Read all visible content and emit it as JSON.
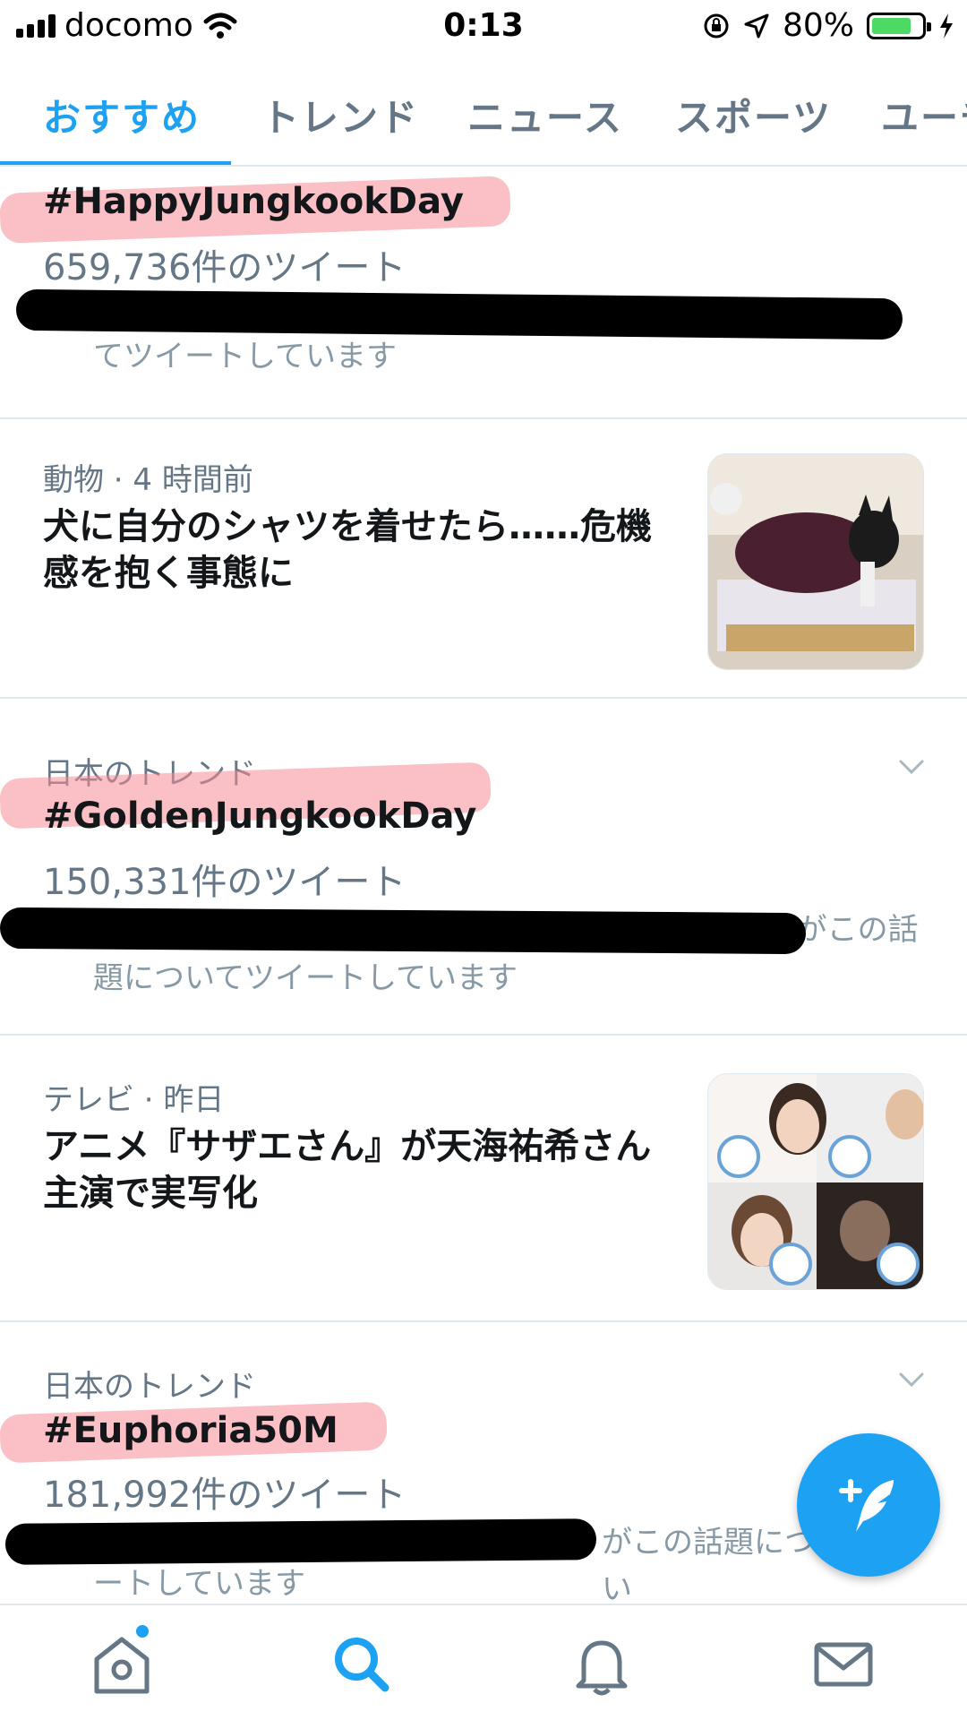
{
  "status_bar": {
    "carrier": "docomo",
    "time": "0:13",
    "battery": "80%",
    "battery_level": 0.8,
    "battery_color": "#4cd964"
  },
  "tabs": [
    {
      "label": "おすすめ",
      "active": true
    },
    {
      "label": "トレンド",
      "active": false
    },
    {
      "label": "ニュース",
      "active": false
    },
    {
      "label": "スポーツ",
      "active": false
    },
    {
      "label": "ユーチ",
      "active": false
    }
  ],
  "feed": {
    "item1": {
      "tag": "#HappyJungkookDay",
      "tweet_count": "659,736件のツイート",
      "desc_line2": "てツイートしています"
    },
    "item2": {
      "meta": "動物 · 4 時間前",
      "headline": "犬に自分のシャツを着せたら……危機感を抱く事態に",
      "thumb_icon": "dog-photo"
    },
    "item3": {
      "meta": "日本のトレンド",
      "tag": "#GoldenJungkookDay",
      "tweet_count": "150,331件のツイート",
      "desc_line1_tail": "他3人がこの話",
      "desc_line2": "題についてツイートしています"
    },
    "item4": {
      "meta": "テレビ · 昨日",
      "headline": "アニメ『サザエさん』が天海祐希さん主演で実写化",
      "thumb_icon": "cast-collage-photo"
    },
    "item5": {
      "meta": "日本のトレンド",
      "tag": "#Euphoria50M",
      "tweet_count": "181,992件のツイート",
      "desc_line1_tail": "がこの話題につい",
      "desc_line2": "ートしています"
    }
  },
  "colors": {
    "accent": "#1da1f2",
    "highlight": "#f58c96",
    "secondary_text": "#657786"
  },
  "bottom_nav": [
    {
      "icon": "home-icon",
      "has_notification_dot": true
    },
    {
      "icon": "search-icon",
      "active": true
    },
    {
      "icon": "bell-icon"
    },
    {
      "icon": "mail-icon"
    }
  ]
}
